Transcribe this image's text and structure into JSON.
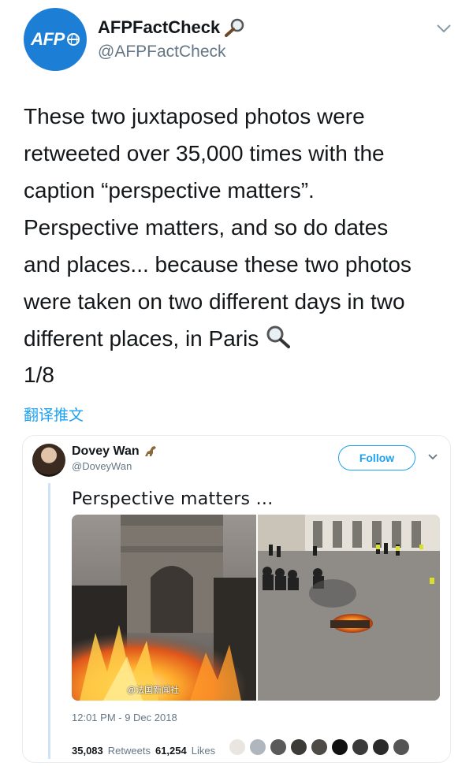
{
  "tweet": {
    "display_name": "AFPFactCheck",
    "handle": "@AFPFactCheck",
    "avatar_logo": "AFP",
    "body": "These two juxtaposed photos were\nretweeted over 35,000 times with the\ncaption “perspective matters”.\nPerspective matters, and so do dates\nand places... because these two photos\nwere taken on two different days in two\ndifferent places, in Paris",
    "thread_count": "1/8",
    "translate_label": "翻译推文",
    "name_icon": "magnifying-glass-icon"
  },
  "quoted": {
    "display_name": "Dovey Wan",
    "handle": "@DoveyWan",
    "name_icon": "dinosaur-emoji-icon",
    "follow_label": "Follow",
    "text": "Perspective matters ...",
    "watermark": "@法国新闻社",
    "timestamp": "12:01 PM - 9 Dec 2018",
    "retweets_count": "35,083",
    "retweets_label": "Retweets",
    "likes_count": "61,254",
    "likes_label": "Likes"
  },
  "colors": {
    "accent": "#1da1f2",
    "afp_blue": "#1d7ed6",
    "muted": "#657786"
  }
}
